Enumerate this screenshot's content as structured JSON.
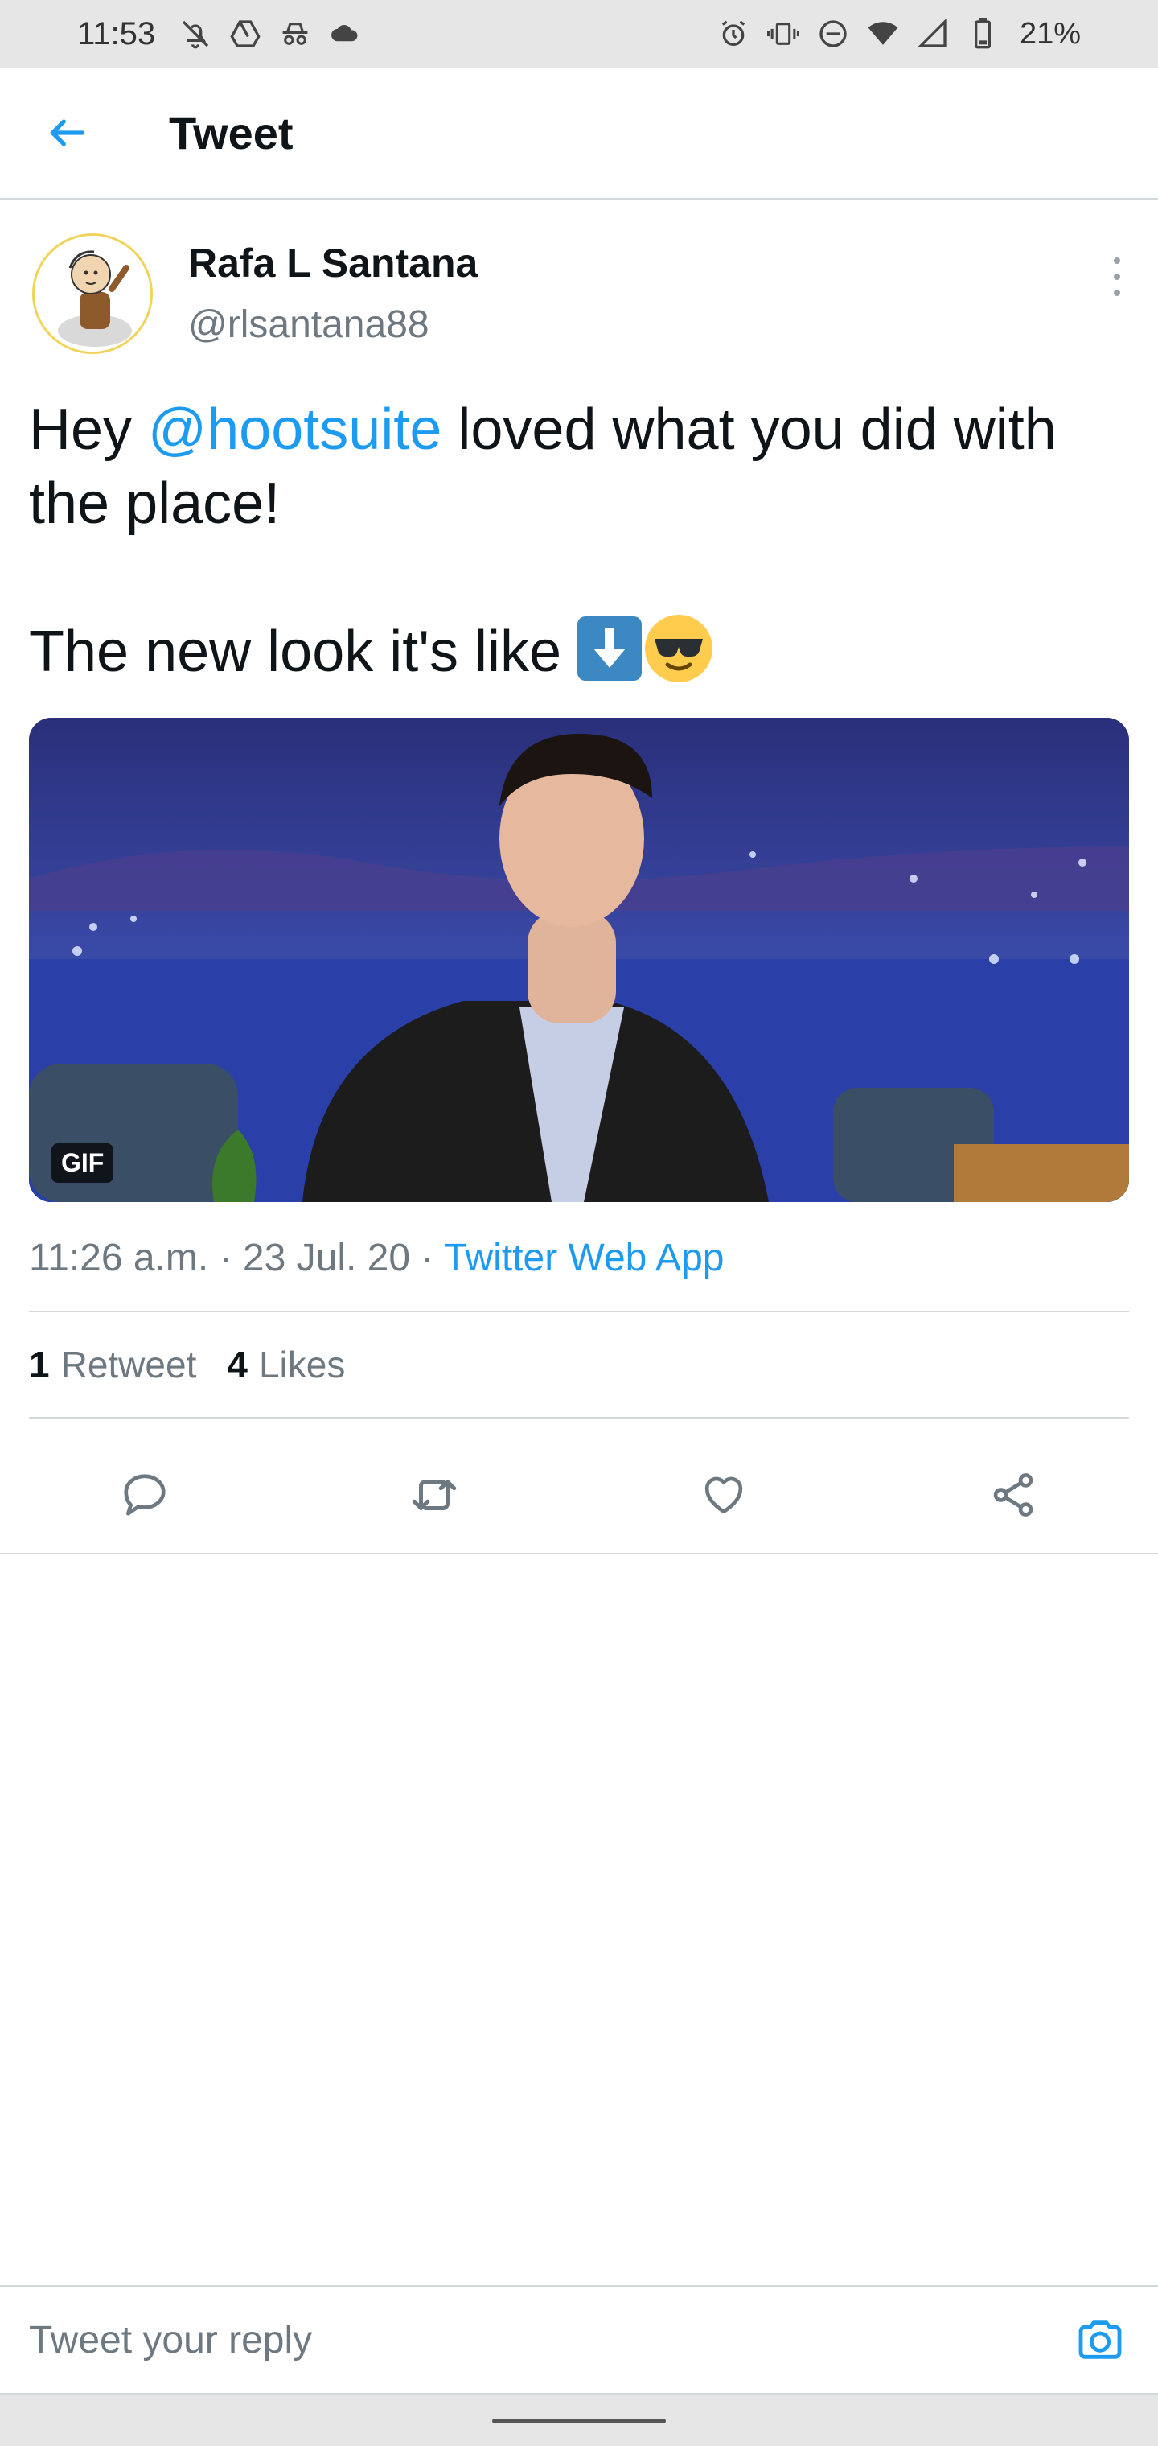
{
  "status_bar": {
    "time": "11:53",
    "battery": "21%",
    "left_icons": [
      "notifications-off-icon",
      "drive-icon",
      "incognito-icon",
      "cloud-icon"
    ],
    "right_icons": [
      "alarm-icon",
      "vibrate-icon",
      "do-not-disturb-icon",
      "wifi-icon",
      "cell-signal-icon",
      "battery-icon"
    ]
  },
  "header": {
    "title": "Tweet",
    "back_icon": "arrow-left-icon"
  },
  "tweet": {
    "author_name": "Rafa L Santana",
    "author_handle": "@rlsantana88",
    "text_line1_prefix": "Hey ",
    "mention": "@hootsuite",
    "text_line1_suffix": " loved what you did with the place!",
    "text_line2": "The new look it's like ",
    "emojis": [
      "down-arrow-emoji",
      "sunglasses-emoji"
    ],
    "media_badge": "GIF",
    "timestamp": "11:26 a.m. · 23 Jul. 20 · ",
    "source": "Twitter Web App",
    "retweet_count": "1",
    "retweet_label": "Retweet",
    "like_count": "4",
    "like_label": "Likes"
  },
  "actions": [
    "reply-icon",
    "retweet-icon",
    "like-icon",
    "share-icon"
  ],
  "reply_bar": {
    "placeholder": "Tweet your reply",
    "camera_icon": "camera-icon"
  },
  "colors": {
    "accent": "#1d9bf0",
    "text": "#0f1419",
    "secondary": "#6e7881",
    "divider": "#d4d8db"
  }
}
